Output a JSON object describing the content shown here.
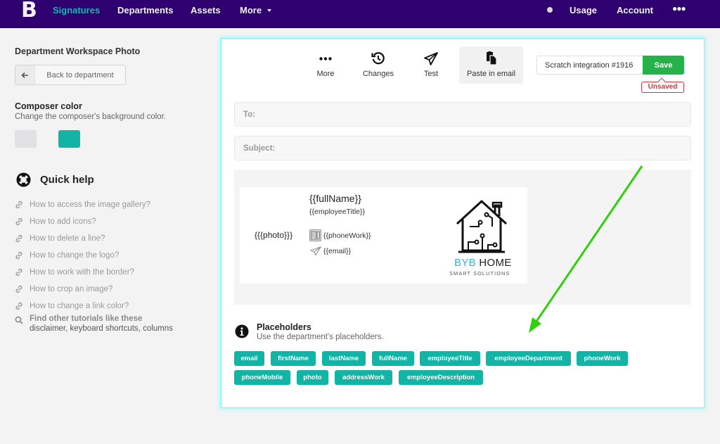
{
  "nav": {
    "logo": "B",
    "links": [
      "Signatures",
      "Departments",
      "Assets",
      "More"
    ],
    "active": "Signatures",
    "right": [
      "Usage",
      "Account"
    ],
    "overflow_icon": "more-horizontal-icon"
  },
  "sidebar": {
    "department_title": "Department Workspace Photo",
    "back_label": "Back to department",
    "composer_color": {
      "title": "Composer color",
      "description": "Change the composer's background color.",
      "swatches": [
        "#e1e1e3",
        "#12b4a6"
      ]
    },
    "quick_help": {
      "title": "Quick help",
      "items": [
        "How to access the image gallery?",
        "How to add icons?",
        "How to delete a line?",
        "How to change the logo?",
        "How to work with the border?",
        "How to crop an image?",
        "How to change a link color?"
      ],
      "find_title": "Find other tutorials like these",
      "find_sub": "disclaimer, keyboard shortcuts, columns"
    }
  },
  "composer": {
    "toolbar": {
      "more": "More",
      "changes": "Changes",
      "test": "Test",
      "paste": "Paste in email"
    },
    "signature_name": "Scratch integration #1916",
    "save_label": "Save",
    "status": "Unsaved",
    "to_label": "To:",
    "subject_label": "Subject:",
    "signature": {
      "photo": "{{{photo}}}",
      "full_name": "{{fullName}}",
      "title": "{{employeeTitle}}",
      "phone": "{{phoneWork}}",
      "email": "{{email}}",
      "logo_brand": "BYB",
      "logo_home": " HOME",
      "logo_tagline": "SMART SOLUTIONS"
    },
    "placeholders": {
      "title": "Placeholders",
      "description": "Use the department's placeholders.",
      "chips": [
        "email",
        "firstName",
        "lastName",
        "fullName",
        "employeeTitle",
        "employeeDepartment",
        "phoneWork",
        "phoneMobile",
        "photo",
        "addressWork",
        "employeeDescription"
      ]
    }
  },
  "colors": {
    "nav_bg": "#2e0070",
    "accent": "#12b4a6",
    "save": "#26b14a",
    "unsaved": "#d6343a",
    "annotation_arrow": "#2fd10e"
  }
}
